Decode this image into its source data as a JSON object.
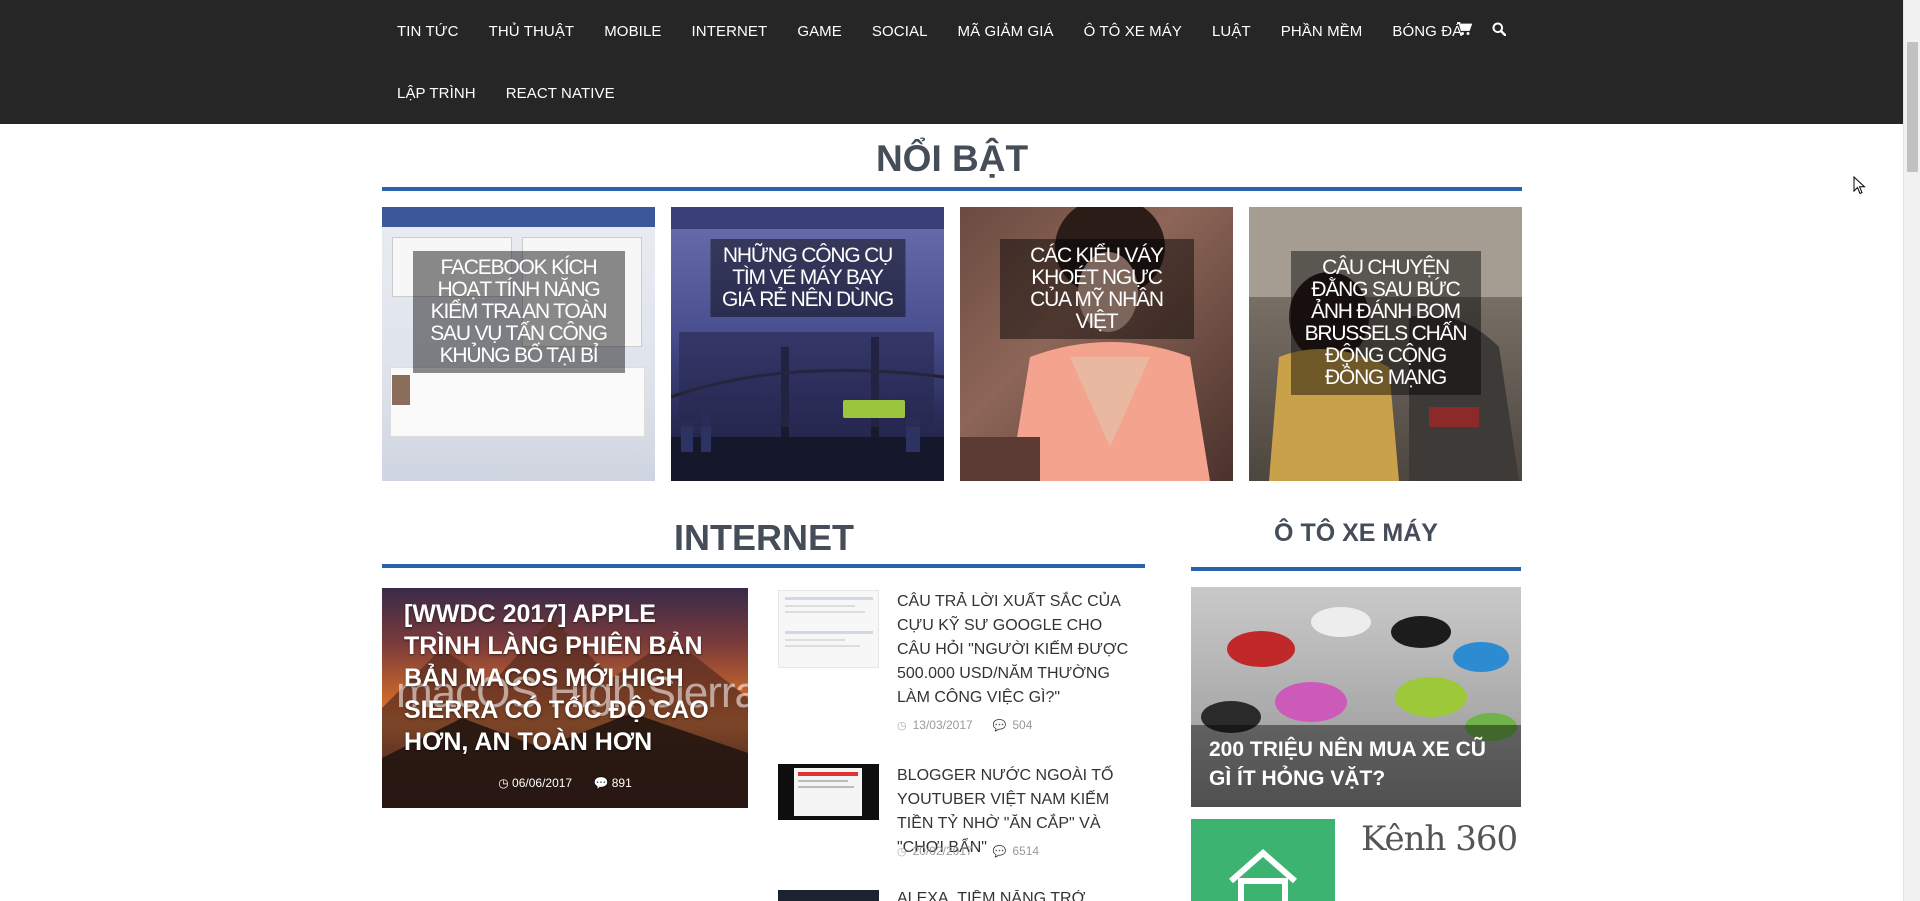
{
  "nav": {
    "row1": [
      "TIN TỨC",
      "THỦ THUẬT",
      "MOBILE",
      "INTERNET",
      "GAME",
      "SOCIAL",
      "MÃ GIẢM GIÁ",
      "Ô TÔ XE MÁY",
      "LUẬT",
      "PHẦN MỀM",
      "BÓNG ĐÁ"
    ],
    "row2": [
      "LẬP TRÌNH",
      "REACT NATIVE"
    ],
    "icons": [
      "cart-icon",
      "search-icon"
    ]
  },
  "featured": {
    "heading": "NỔI BẬT",
    "items": [
      {
        "title": "FACEBOOK KÍCH HOẠT TÍNH NĂNG KIỂM TRA AN TOÀN SAU VỤ TẤN CÔNG KHỦNG BỐ TẠI BỈ"
      },
      {
        "title": "NHỮNG CÔNG CỤ TÌM VÉ MÁY BAY GIÁ RẺ NÊN DÙNG"
      },
      {
        "title": "CÁC KIỂU VÁY KHOÉT NGỰC CỦA MỸ NHÂN VIỆT"
      },
      {
        "title": "CÂU CHUYỆN ĐẰNG SAU BỨC ẢNH ĐÁNH BOM BRUSSELS CHẤN ĐỘNG CỘNG ĐỒNG MẠNG"
      }
    ]
  },
  "internet": {
    "heading": "INTERNET",
    "main": {
      "title": "[WWDC 2017] APPLE TRÌNH LÀNG PHIÊN BẢN BẢN MACOS MỚI HIGH SIERRA CÓ TỐC ĐỘ CAO HƠN, AN TOÀN HƠN",
      "date": "06/06/2017",
      "comments": "891",
      "watermark": "macOS High Sierra"
    },
    "items": [
      {
        "title": "CÂU TRẢ LỜI XUẤT SẮC CỦA CỰU KỸ SƯ GOOGLE CHO CÂU HỎI \"NGƯỜI KIẾM ĐƯỢC 500.000 USD/NĂM THƯỜNG LÀM CÔNG VIỆC GÌ?\"",
        "date": "13/03/2017",
        "comments": "504"
      },
      {
        "title": "BLOGGER NƯỚC NGOÀI TỐ YOUTUBER VIỆT NAM KIẾM TIỀN TỶ NHỜ \"ĂN CẮP\" VÀ \"CHƠI BẨN\"",
        "date": "20/02/2017",
        "comments": "6514"
      },
      {
        "title": "ALEXA, TIỀM NĂNG TRỞ THÀNH"
      }
    ]
  },
  "sidebar": {
    "heading": "Ô TÔ XE MÁY",
    "card_title": "200 TRIỆU NÊN MUA XE CŨ GÌ ÍT HỎNG VẶT?",
    "ad_text": "Kênh 360"
  },
  "colors": {
    "nav_bg": "#262626",
    "accent": "#2a63ad",
    "heading": "#454d59"
  }
}
